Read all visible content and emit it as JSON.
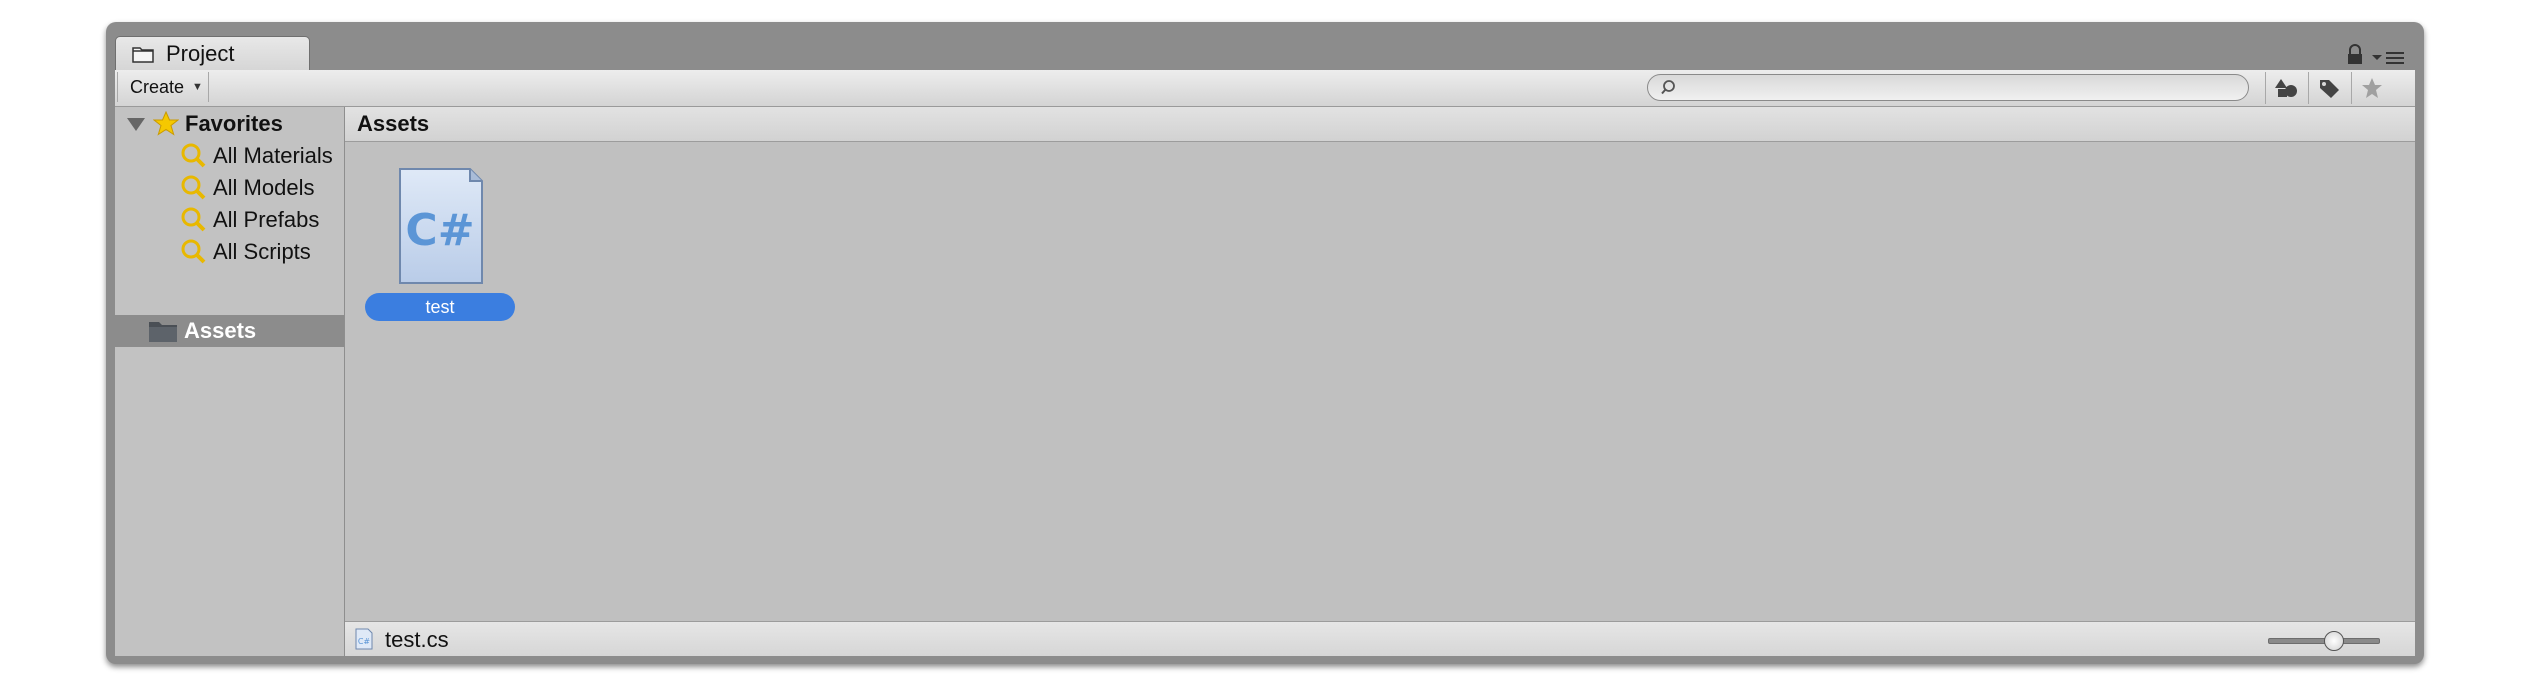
{
  "window": {
    "tab_title": "Project"
  },
  "toolbar": {
    "create_label": "Create",
    "search_placeholder": ""
  },
  "sidebar": {
    "favorites_label": "Favorites",
    "items": [
      {
        "label": "All Materials"
      },
      {
        "label": "All Models"
      },
      {
        "label": "All Prefabs"
      },
      {
        "label": "All Scripts"
      }
    ],
    "assets_label": "Assets"
  },
  "main": {
    "title": "Assets",
    "assets": [
      {
        "name": "test",
        "icon": "csharp-script-icon",
        "selected": true
      }
    ]
  },
  "status": {
    "selected_file": "test.cs",
    "zoom_fraction": 0.6
  },
  "colors": {
    "selection": "#3b7ee0",
    "window_frame": "#8c8c8c",
    "panel_bg": "#c0c0c0"
  }
}
